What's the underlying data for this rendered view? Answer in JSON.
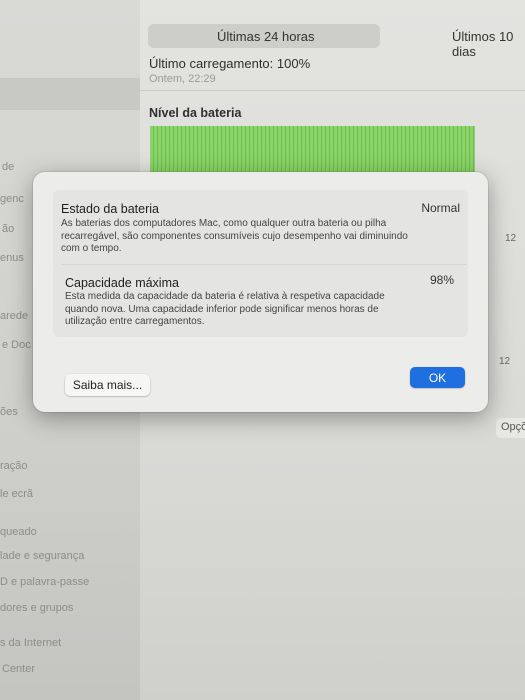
{
  "header": {
    "segment_selected": "Últimas 24 horas",
    "segment_other": "Últimos 10 dias"
  },
  "battery_summary": {
    "last_charge": "Último carregamento: 100%",
    "last_charge_time": "Ontem, 22:29",
    "section_title": "Nível da bateria"
  },
  "chart_axis": {
    "tick_a": "12",
    "tick_b": "12"
  },
  "options_button": "Opções",
  "sidebar": {
    "items": [
      "de",
      "genc",
      "ão",
      "enus",
      "arede",
      "e Doc",
      "ões",
      "ração",
      "le ecrã",
      "queado",
      "lade e segurança",
      "D e palavra-passe",
      "dores e grupos",
      "s da Internet",
      "Center"
    ]
  },
  "dialog": {
    "status_title": "Estado da bateria",
    "status_value": "Normal",
    "status_desc": "As baterias dos computadores Mac, como qualquer outra bateria ou pilha recarregável, são componentes consumíveis cujo desempenho vai diminuindo com o tempo.",
    "capacity_title": "Capacidade máxima",
    "capacity_value": "98%",
    "capacity_desc": "Esta medida da capacidade da bateria é relativa à respetiva capacidade quando nova. Uma capacidade inferior pode significar menos horas de utilização entre carregamentos.",
    "learn_more_label": "Saiba mais...",
    "ok_label": "OK"
  },
  "colors": {
    "accent": "#1f6fe0",
    "chart_green": "#8bd36a"
  }
}
